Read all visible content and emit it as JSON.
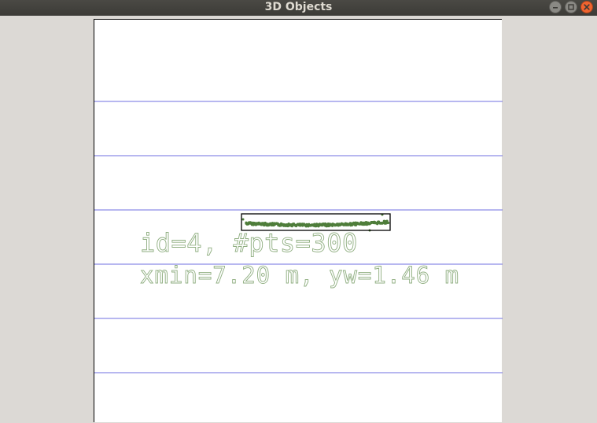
{
  "window": {
    "title": "3D Objects"
  },
  "icons": {
    "minimize": "minimize-icon",
    "maximize": "maximize-icon",
    "close": "close-icon"
  },
  "colors": {
    "titlebar": "#3c3b37",
    "title_text": "#dfdbd2",
    "close_button": "#f0642f",
    "grid_line": "#6f6fe0",
    "point_cloud": "#4e7d3a",
    "label_text": "#8fae80",
    "bounding_box": "#000000"
  },
  "object": {
    "id_label": "id=4, #pts=300",
    "info_label": "xmin=7.20 m, yw=1.46 m",
    "num_points": 300
  }
}
